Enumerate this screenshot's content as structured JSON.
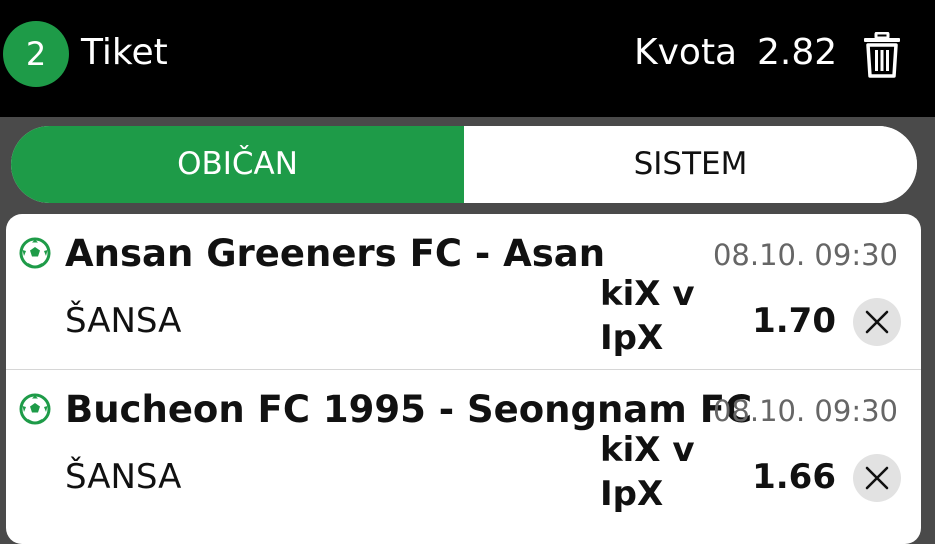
{
  "header": {
    "count": "2",
    "title": "Tiket",
    "odds_label": "Kvota",
    "odds_value": "2.82"
  },
  "tabs": [
    {
      "label": "OBIČAN",
      "active": true
    },
    {
      "label": "SISTEM",
      "active": false
    }
  ],
  "bets": [
    {
      "match": "Ansan Greeners FC - Asan",
      "datetime": "08.10. 09:30",
      "bet_type": "ŠANSA",
      "pick": "kiX v\nIpX",
      "odds": "1.70",
      "sport_icon": "soccer-ball-icon"
    },
    {
      "match": "Bucheon FC 1995 - Seongnam FC",
      "datetime": "08.10. 09:30",
      "bet_type": "ŠANSA",
      "pick": "kiX v\nIpX",
      "odds": "1.66",
      "sport_icon": "soccer-ball-icon"
    }
  ],
  "colors": {
    "accent": "#1e9b48",
    "header_bg": "#000000"
  }
}
